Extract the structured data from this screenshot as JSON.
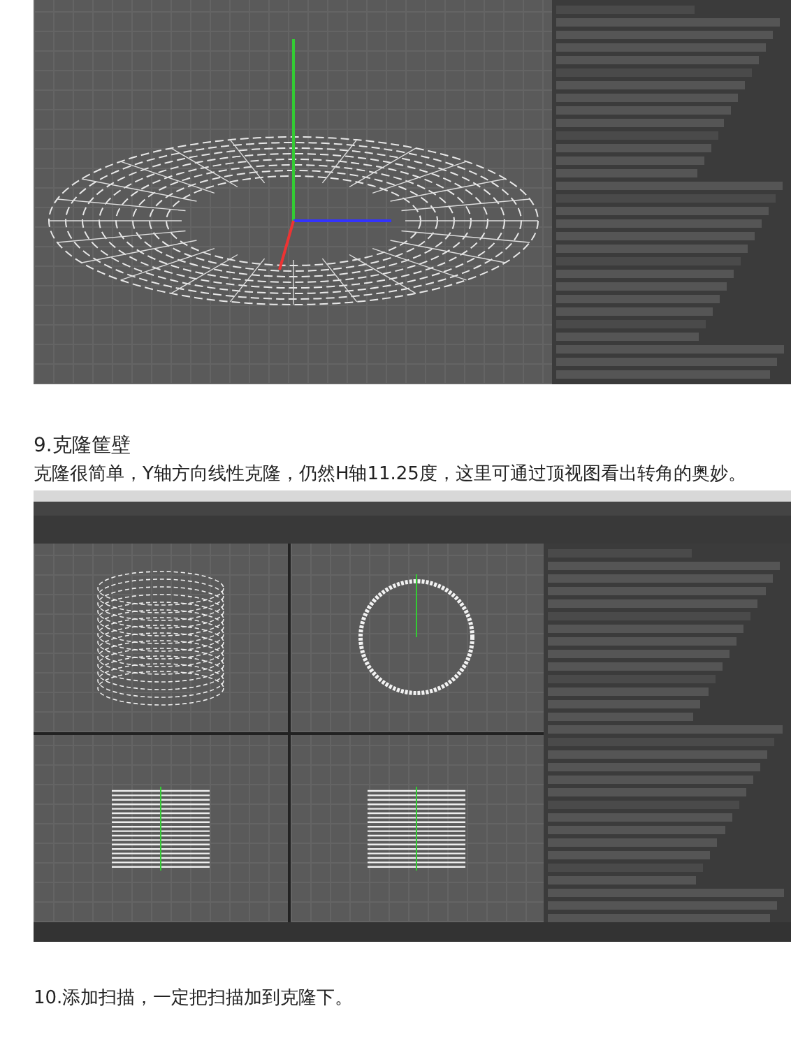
{
  "blocks": [
    {
      "kind": "single_view_screenshot"
    },
    {
      "kind": "heading",
      "text": "9.克隆筐壁"
    },
    {
      "kind": "paragraph",
      "text": "克隆很简单，Y轴方向线性克隆，仍然H轴11.25度，这里可通过顶视图看出转角的奥妙。"
    },
    {
      "kind": "four_view_screenshot"
    },
    {
      "kind": "paragraph",
      "text": "10.添加扫描，一定把扫描加到克隆下。"
    }
  ]
}
